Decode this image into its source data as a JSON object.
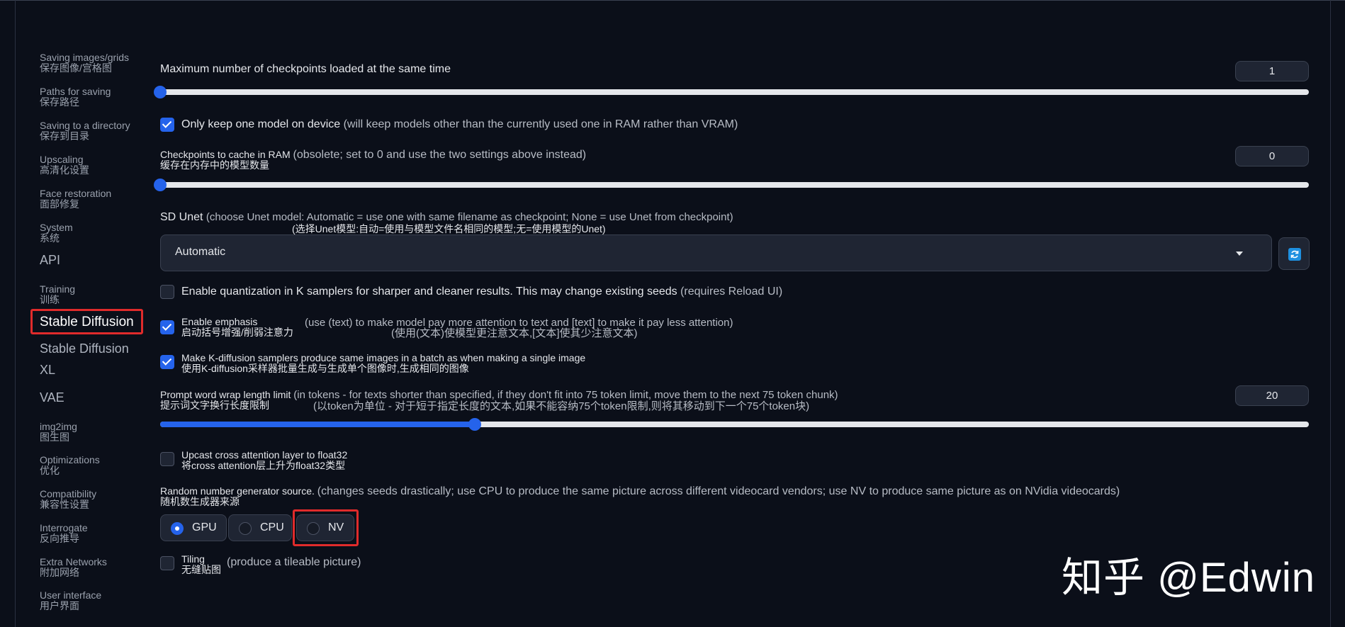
{
  "sidebar": {
    "items": [
      {
        "en": "Saving images/grids",
        "zh": "保存图像/宫格图"
      },
      {
        "en": "Paths for saving",
        "zh": "保存路径"
      },
      {
        "en": "Saving to a directory",
        "zh": "保存到目录"
      },
      {
        "en": "Upscaling",
        "zh": "高清化设置"
      },
      {
        "en": "Face restoration",
        "zh": "面部修复"
      },
      {
        "en": "System",
        "zh": "系统"
      },
      {
        "label": "API"
      },
      {
        "en": "Training",
        "zh": "训练"
      },
      {
        "label": "Stable Diffusion"
      },
      {
        "label": "Stable Diffusion",
        "label2": "XL"
      },
      {
        "label": "VAE"
      },
      {
        "en": "img2img",
        "zh": "图生图"
      },
      {
        "en": "Optimizations",
        "zh": "优化"
      },
      {
        "en": "Compatibility",
        "zh": "兼容性设置"
      },
      {
        "en": "Interrogate",
        "zh": "反向推导"
      },
      {
        "en": "Extra Networks",
        "zh": "附加网络"
      },
      {
        "en": "User interface",
        "zh": "用户界面"
      }
    ],
    "active_index": 8
  },
  "settings": {
    "max_checkpoints": {
      "label": "Maximum number of checkpoints loaded at the same time",
      "value": "1",
      "slider_fraction": 0.0
    },
    "one_model": {
      "label": "Only keep one model on device",
      "note": "(will keep models other than the currently used one in RAM rather than VRAM)",
      "checked": true
    },
    "cache_ram": {
      "label": "Checkpoints to cache in RAM",
      "note": "(obsolete; set to 0 and use the two settings above instead)",
      "zh": "缓存在内存中的模型数量",
      "value": "0",
      "slider_fraction": 0.0
    },
    "sd_unet": {
      "label": "SD Unet",
      "note": "(choose Unet model: Automatic = use one with same filename as checkpoint; None = use Unet from checkpoint)",
      "zh": "(选择Unet模型:自动=使用与模型文件名相同的模型;无=使用模型的Unet)",
      "selected": "Automatic"
    },
    "quantization": {
      "label": "Enable quantization in K samplers for sharper and cleaner results. This may change existing seeds",
      "note": "(requires Reload UI)",
      "checked": false
    },
    "emphasis": {
      "label": "Enable emphasis",
      "zh": "启动括号增强/削弱注意力",
      "note": "(use (text) to make model pay more attention to text and [text] to make it pay less attention)",
      "note_zh": "(使用(文本)使模型更注意文本,[文本]使其少注意文本)",
      "checked": true
    },
    "kdiffusion": {
      "label": "Make K-diffusion samplers produce same images in a batch as when making a single image",
      "zh": "使用K-diffusion采样器批量生成与生成单个图像时,生成相同的图像",
      "checked": true
    },
    "wrap_limit": {
      "label": "Prompt word wrap length limit",
      "note": "(in tokens - for texts shorter than specified, if they don't fit into 75 token limit, move them to the next 75 token chunk)",
      "zh": "提示词文字换行长度限制",
      "note_zh": "(以token为单位 - 对于短于指定长度的文本,如果不能容纳75个token限制,则将其移动到下一个75个token块)",
      "value": "20",
      "slider_fraction": 0.274
    },
    "upcast": {
      "label": "Upcast cross attention layer to float32",
      "zh": "将cross attention层上升为float32类型",
      "checked": false
    },
    "rng": {
      "label": "Random number generator source.",
      "note": "(changes seeds drastically; use CPU to produce the same picture across different videocard vendors; use NV to produce same picture as on NVidia videocards)",
      "zh": "随机数生成器来源",
      "options": [
        "GPU",
        "CPU",
        "NV"
      ],
      "selected": "GPU"
    },
    "tiling": {
      "label": "Tiling",
      "zh": "无缝贴图",
      "note": "(produce a tileable picture)",
      "checked": false
    }
  },
  "watermark": "知乎 @Edwin",
  "colors": {
    "accent": "#2563eb",
    "highlight": "#e02b2b",
    "background": "#0b0f19"
  }
}
